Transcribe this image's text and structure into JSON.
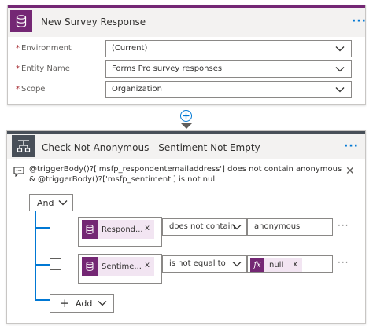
{
  "trigger": {
    "title": "New Survey Response",
    "more": "···",
    "fields": [
      {
        "required": "*",
        "label": "Environment",
        "value": "(Current)"
      },
      {
        "required": "*",
        "label": "Entity Name",
        "value": "Forms Pro survey responses"
      },
      {
        "required": "*",
        "label": "Scope",
        "value": "Organization"
      }
    ]
  },
  "condition": {
    "title": "Check Not Anonymous - Sentiment Not Empty",
    "more": "···",
    "expression": "@triggerBody()?['msfp_respondentemailaddress'] does not contain anonymous & @triggerBody()?['msfp_sentiment'] is not null",
    "close": "✕",
    "group_operator": "And",
    "rows": [
      {
        "token": "Respond...",
        "token_remove": "x",
        "operator": "does not contain",
        "value": "anonymous",
        "more": "···"
      },
      {
        "token": "Sentime...",
        "token_remove": "x",
        "operator": "is not equal to",
        "value_token": "null",
        "value_token_remove": "x",
        "more": "···"
      }
    ],
    "add_label": "Add"
  },
  "colors": {
    "dataverse_purple": "#742774",
    "condition_gray": "#484f58",
    "accent_blue": "#0078d4",
    "required_red": "#a4262c"
  },
  "icons": {
    "trigger": "database-icon",
    "condition": "condition-icon",
    "insert": "add-circle-icon",
    "expression": "comment-icon",
    "fx": "function-icon"
  }
}
